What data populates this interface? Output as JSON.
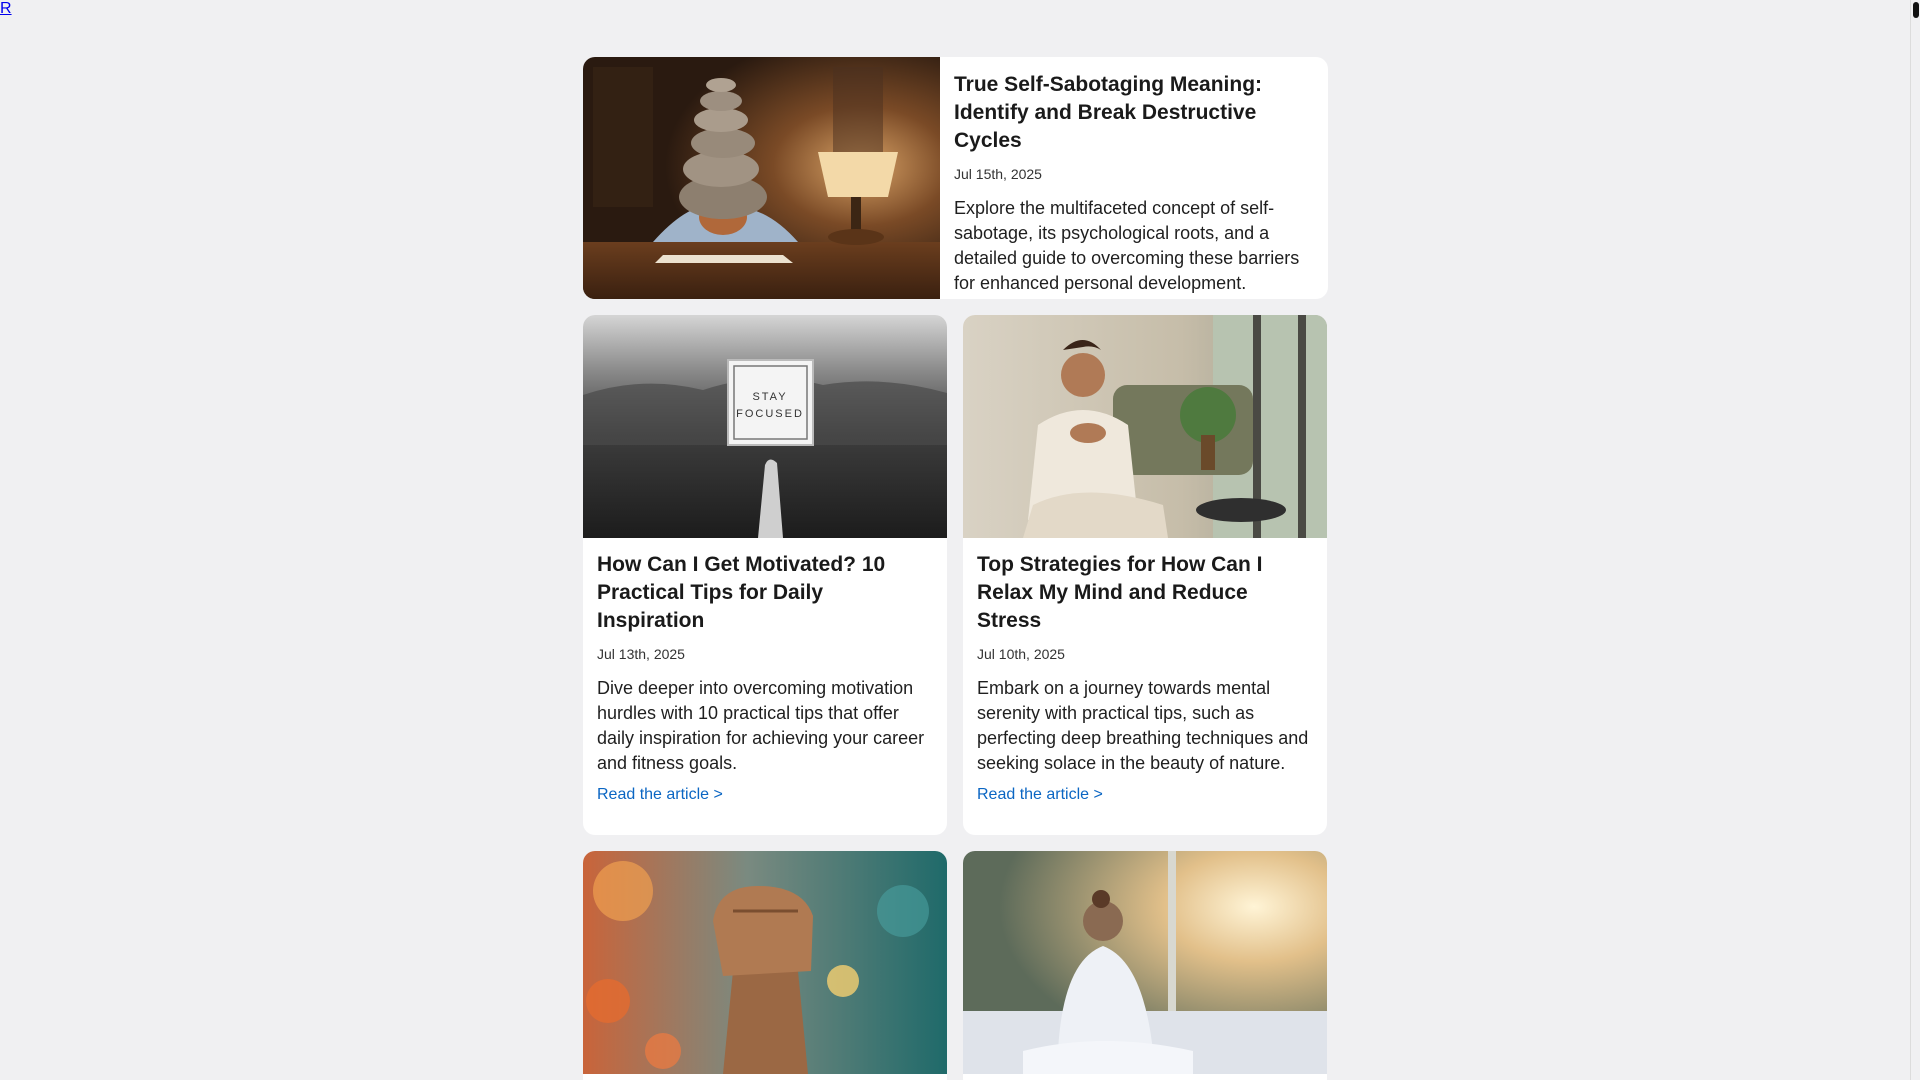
{
  "articles": [
    {
      "title": "True Self-Sabotaging Meaning: Identify and Break Destructive Cycles",
      "date": "Jul 15th, 2025",
      "excerpt": "Explore the multifaceted concept of self-sabotage, its psychological roots, and a detailed guide to overcoming these barriers for enhanced personal development.",
      "read_label": "R",
      "image": "stacked-stones-head-desk-image"
    },
    {
      "title": "How Can I Get Motivated? 10 Practical Tips for Daily Inspiration",
      "date": "Jul 13th, 2025",
      "excerpt": "Dive deeper into overcoming motivation hurdles with 10 practical tips that offer daily inspiration for achieving your career and fitness goals.",
      "read_label": "Read the article >",
      "image": "stay-focused-sign-image",
      "sign_text_1": "STAY",
      "sign_text_2": "FOCUSED"
    },
    {
      "title": "Top Strategies for How Can I Relax My Mind and Reduce Stress",
      "date": "Jul 10th, 2025",
      "excerpt": "Embark on a journey towards mental serenity with practical tips, such as perfecting deep breathing techniques and seeking solace in the beauty of nature.",
      "read_label": "Read the article >",
      "image": "woman-breathing-living-room-image"
    },
    {
      "image": "raised-fist-bokeh-image"
    },
    {
      "image": "woman-window-sunrise-image"
    }
  ],
  "colors": {
    "background": "#f0f0f2",
    "card": "#ffffff",
    "link": "#0b66c3"
  }
}
